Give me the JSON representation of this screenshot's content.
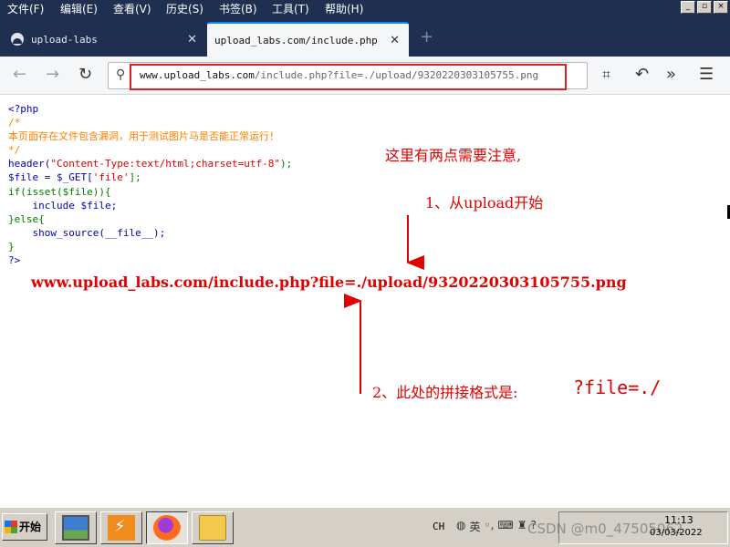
{
  "menu": [
    "文件(F)",
    "编辑(E)",
    "查看(V)",
    "历史(S)",
    "书签(B)",
    "工具(T)",
    "帮助(H)"
  ],
  "window_controls": [
    "_",
    "▫",
    "×"
  ],
  "tabs": [
    {
      "label": "upload-labs",
      "icon": "site-icon",
      "active": false
    },
    {
      "label": "upload_labs.com/include.php",
      "icon": "none",
      "active": true
    }
  ],
  "nav": {
    "url_domain": "www.upload_labs.com",
    "url_rest": "/include.php?file=./upload/9320220303105755.png",
    "back_icon": "arrow-left-icon",
    "forward_icon": "arrow-right-icon",
    "reload_icon": "reload-icon",
    "crop_icon": "crop-icon",
    "undo_icon": "undo-icon",
    "overflow_icon": "double-chevron-icon",
    "menu_icon": "hamburger-icon"
  },
  "code": {
    "l1": "<?php",
    "l2": "/*",
    "l3": "本页面存在文件包含漏洞，用于测试图片马是否能正常运行！",
    "l4": "*/",
    "l5a": "header(",
    "l5b": "\"Content-Type:text/html;charset=utf-8\"",
    "l5c": ");",
    "l6a": "$file = $_GET[",
    "l6b": "'file'",
    "l6c": "];",
    "l7": "if(isset($file)){",
    "l8": "    include $file;",
    "l9": "}else{",
    "l10": "    show_source(__file__);",
    "l11": "}",
    "l12": "?>"
  },
  "annotations": {
    "note_intro": "这里有两点需要注意,",
    "note_1": "1、从upload开始",
    "example_url": "www.upload_labs.com/include.php?file=./upload/9320220303105755.png",
    "note_2": "2、此处的拼接格式是:",
    "note_2_value": "?file=./"
  },
  "colors": {
    "annotation_red": "#e00000",
    "php_blue": "#0000bb",
    "php_comment": "#ff8000",
    "php_keyword": "#007700",
    "php_string": "#dd0000"
  },
  "taskbar": {
    "start_label": "开始",
    "ime": "CH",
    "clock_time": "11:13",
    "clock_date": "03/03/2022",
    "watermark": "CSDN @m0_47505062"
  }
}
